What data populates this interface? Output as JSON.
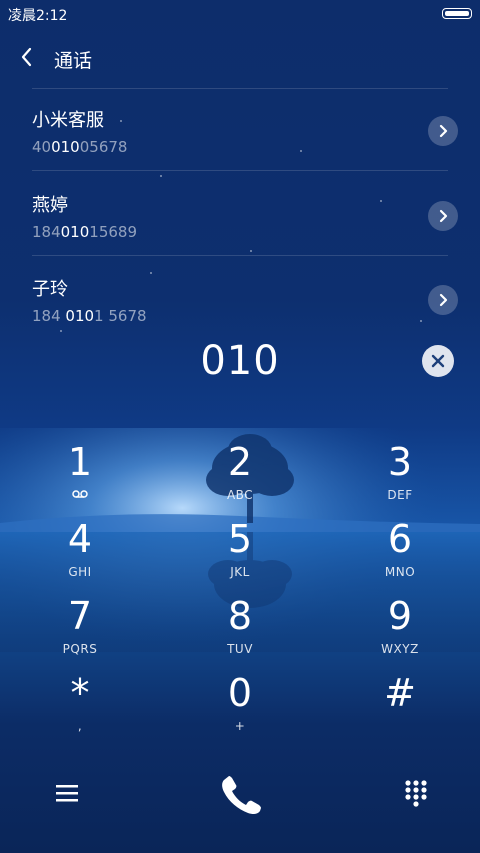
{
  "status": {
    "time": "凌晨2:12"
  },
  "header": {
    "title": "通话"
  },
  "contacts": [
    {
      "name": "小米客服",
      "number_pre": "40",
      "number_match": "010",
      "number_post": "05678"
    },
    {
      "name": "燕婷",
      "number_pre": "184",
      "number_match": "010",
      "number_post": "15689"
    },
    {
      "name": "子玲",
      "number_pre": "184 ",
      "number_match": "010",
      "number_post": "1 5678"
    }
  ],
  "input": {
    "value": "010"
  },
  "keypad": [
    {
      "digit": "1",
      "letters": ""
    },
    {
      "digit": "2",
      "letters": "ABC"
    },
    {
      "digit": "3",
      "letters": "DEF"
    },
    {
      "digit": "4",
      "letters": "GHI"
    },
    {
      "digit": "5",
      "letters": "JKL"
    },
    {
      "digit": "6",
      "letters": "MNO"
    },
    {
      "digit": "7",
      "letters": "PQRS"
    },
    {
      "digit": "8",
      "letters": "TUV"
    },
    {
      "digit": "9",
      "letters": "WXYZ"
    },
    {
      "digit": "*",
      "letters": ","
    },
    {
      "digit": "0",
      "letters": "+"
    },
    {
      "digit": "#",
      "letters": ""
    }
  ],
  "icons": {
    "back": "chevron-left-icon",
    "detail": "chevron-right-icon",
    "clear": "close-icon",
    "voicemail": "voicemail-icon",
    "menu": "menu-icon",
    "call": "phone-icon",
    "keypad": "dialpad-icon"
  },
  "colors": {
    "background": "#0d2d6b",
    "accent": "#ffffff",
    "clear_button": "#dfe4ee"
  }
}
